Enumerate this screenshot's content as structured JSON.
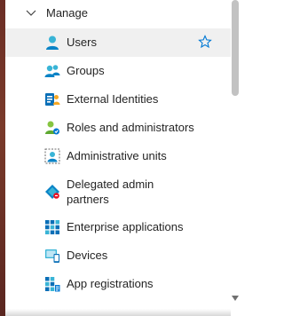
{
  "section": {
    "label": "Manage",
    "expanded": true
  },
  "nav_items": [
    {
      "label": "Users",
      "icon": "user-icon",
      "selected": true,
      "favorite": true
    },
    {
      "label": "Groups",
      "icon": "groups-icon"
    },
    {
      "label": "External Identities",
      "icon": "external-identities-icon"
    },
    {
      "label": "Roles and administrators",
      "icon": "roles-icon"
    },
    {
      "label": "Administrative units",
      "icon": "administrative-units-icon"
    },
    {
      "label_line1": "Delegated admin",
      "label_line2": "partners",
      "icon": "delegated-admin-icon"
    },
    {
      "label": "Enterprise applications",
      "icon": "enterprise-apps-icon"
    },
    {
      "label": "Devices",
      "icon": "devices-icon"
    },
    {
      "label": "App registrations",
      "icon": "app-registrations-icon"
    }
  ],
  "colors": {
    "accent": "#0078d4",
    "selected_bg": "#f0f0f0",
    "text": "#242424"
  }
}
